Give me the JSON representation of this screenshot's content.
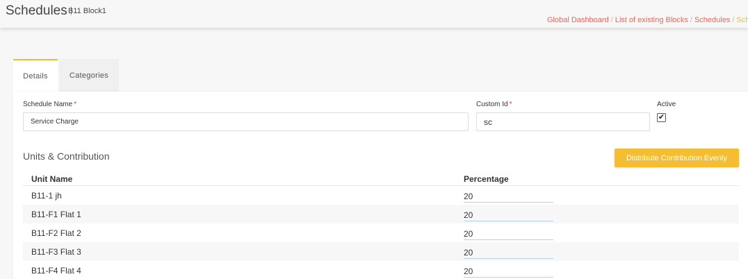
{
  "header": {
    "title": "Schedules",
    "separator": "|",
    "subtitle": "B11 Block1",
    "breadcrumb": [
      "Global Dashboard",
      "List of existing Blocks",
      "Schedules",
      "Sche"
    ]
  },
  "tabs": [
    {
      "label": "Details",
      "active": true
    },
    {
      "label": "Categories",
      "active": false
    }
  ],
  "form": {
    "schedule_name_label": "Schedule Name",
    "schedule_name_value": "Service Charge",
    "custom_id_label": "Custom Id",
    "custom_id_value": "sc",
    "active_label": "Active",
    "active_checked": true,
    "required_mark": "*"
  },
  "units": {
    "section_title": "Units & Contribution",
    "distribute_button": "Distribute Contribution Evenly",
    "columns": [
      "Unit Name",
      "Percentage"
    ],
    "rows": [
      {
        "name": "B11-1 jh",
        "percentage": "20"
      },
      {
        "name": "B11-F1 Flat 1",
        "percentage": "20"
      },
      {
        "name": "B11-F2 Flat 2",
        "percentage": "20"
      },
      {
        "name": "B11-F3 Flat 3",
        "percentage": "20"
      },
      {
        "name": "B11-F4 Flat 4",
        "percentage": "20"
      }
    ]
  },
  "colors": {
    "accent": "#f5b938",
    "breadcrumb_link": "#e8675a",
    "required": "#e53935"
  }
}
